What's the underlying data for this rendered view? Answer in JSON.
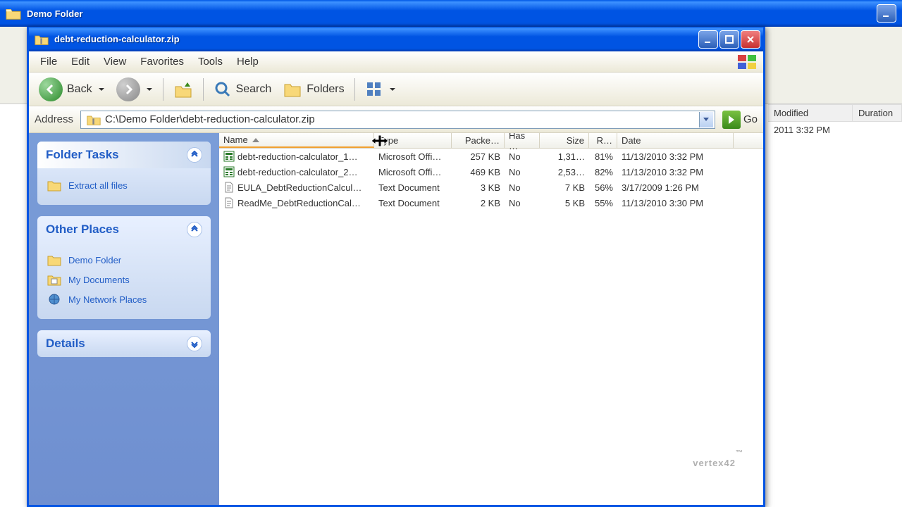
{
  "parent_window": {
    "title": "Demo Folder",
    "headers": {
      "modified": "Modified",
      "duration": "Duration"
    },
    "row": {
      "modified": "2011 3:32 PM"
    }
  },
  "window": {
    "title": "debt-reduction-calculator.zip"
  },
  "menu": {
    "file": "File",
    "edit": "Edit",
    "view": "View",
    "favorites": "Favorites",
    "tools": "Tools",
    "help": "Help"
  },
  "toolbar": {
    "back": "Back",
    "search": "Search",
    "folders": "Folders"
  },
  "addressbar": {
    "label": "Address",
    "value": "C:\\Demo Folder\\debt-reduction-calculator.zip",
    "go": "Go"
  },
  "side": {
    "folder_tasks": {
      "title": "Folder Tasks",
      "extract": "Extract all files"
    },
    "other_places": {
      "title": "Other Places",
      "items": [
        "Demo Folder",
        "My Documents",
        "My Network Places"
      ]
    },
    "details": {
      "title": "Details"
    }
  },
  "columns": {
    "name": "Name",
    "type": "Type",
    "packed": "Packe…",
    "has": "Has …",
    "size": "Size",
    "ratio": "R…",
    "date": "Date"
  },
  "files": [
    {
      "name": "debt-reduction-calculator_1…",
      "type": "Microsoft Offi…",
      "packed": "257 KB",
      "has": "No",
      "size": "1,31…",
      "ratio": "81%",
      "date": "11/13/2010 3:32 PM",
      "icon": "xls"
    },
    {
      "name": "debt-reduction-calculator_2…",
      "type": "Microsoft Offi…",
      "packed": "469 KB",
      "has": "No",
      "size": "2,53…",
      "ratio": "82%",
      "date": "11/13/2010 3:32 PM",
      "icon": "xls"
    },
    {
      "name": "EULA_DebtReductionCalcul…",
      "type": "Text Document",
      "packed": "3 KB",
      "has": "No",
      "size": "7 KB",
      "ratio": "56%",
      "date": "3/17/2009 1:26 PM",
      "icon": "txt"
    },
    {
      "name": "ReadMe_DebtReductionCal…",
      "type": "Text Document",
      "packed": "2 KB",
      "has": "No",
      "size": "5 KB",
      "ratio": "55%",
      "date": "11/13/2010 3:30 PM",
      "icon": "txt"
    }
  ],
  "watermark": "vertex42"
}
